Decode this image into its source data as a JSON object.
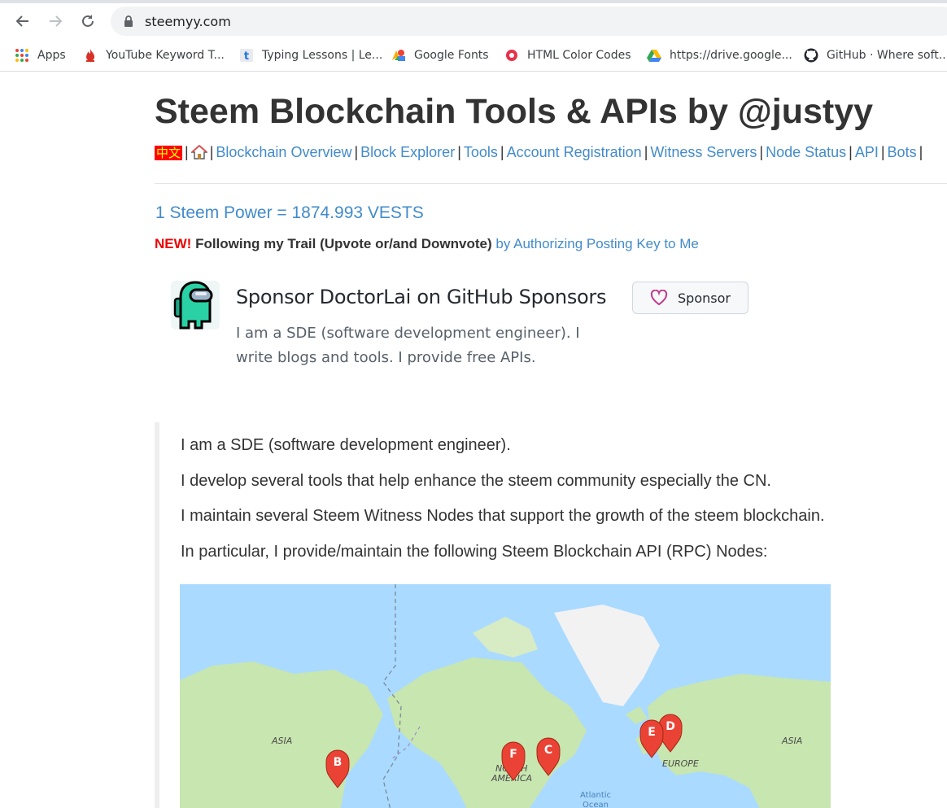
{
  "browser": {
    "url": "steemyy.com",
    "bookmarks": [
      {
        "label": "Apps",
        "icon": "apps-grid-icon"
      },
      {
        "label": "YouTube Keyword T...",
        "icon": "flame-icon"
      },
      {
        "label": "Typing Lessons | Le...",
        "icon": "typing-t-icon"
      },
      {
        "label": "Google Fonts",
        "icon": "google-fonts-icon"
      },
      {
        "label": "HTML Color Codes",
        "icon": "color-codes-icon"
      },
      {
        "label": "https://drive.google...",
        "icon": "google-drive-icon"
      },
      {
        "label": "GitHub · Where soft...",
        "icon": "github-icon"
      }
    ]
  },
  "page": {
    "title": "Steem Blockchain Tools & APIs by @justyy",
    "nav": {
      "chinese": "中文",
      "links": [
        "Blockchain Overview",
        "Block Explorer",
        "Tools",
        "Account Registration",
        "Witness Servers",
        "Node Status",
        "API",
        "Bots"
      ],
      "separator": "|"
    },
    "vests": "1 Steem Power = 1874.993 VESTS",
    "new_label": "NEW!",
    "trail_text": "Following my Trail (Upvote or/and Downvote)",
    "trail_link": "by Authorizing Posting Key to Me",
    "sponsor": {
      "title": "Sponsor DoctorLai on GitHub Sponsors",
      "description": "I am a SDE (software development engineer). I write blogs and tools. I provide free APIs.",
      "button": "Sponsor"
    },
    "quote": [
      "I am a SDE (software development engineer).",
      "I develop several tools that help enhance the steem community especially the CN.",
      "I maintain several Steem Witness Nodes that support the growth of the steem blockchain.",
      "In particular, I provide/maintain the following Steem Blockchain API (RPC) Nodes:"
    ],
    "map": {
      "labels": {
        "asia_left": "ASIA",
        "asia_right": "ASIA",
        "europe": "EUROPE",
        "north_america_1": "NORTH",
        "north_america_2": "AMERICA",
        "atlantic_1": "Atlantic",
        "atlantic_2": "Ocean"
      },
      "markers": [
        "B",
        "F",
        "C",
        "E",
        "D"
      ],
      "colors": {
        "water": "#aadaff",
        "land": "#c8e6b0",
        "ice": "#f2f2f2",
        "marker": "#ea4335"
      }
    }
  }
}
